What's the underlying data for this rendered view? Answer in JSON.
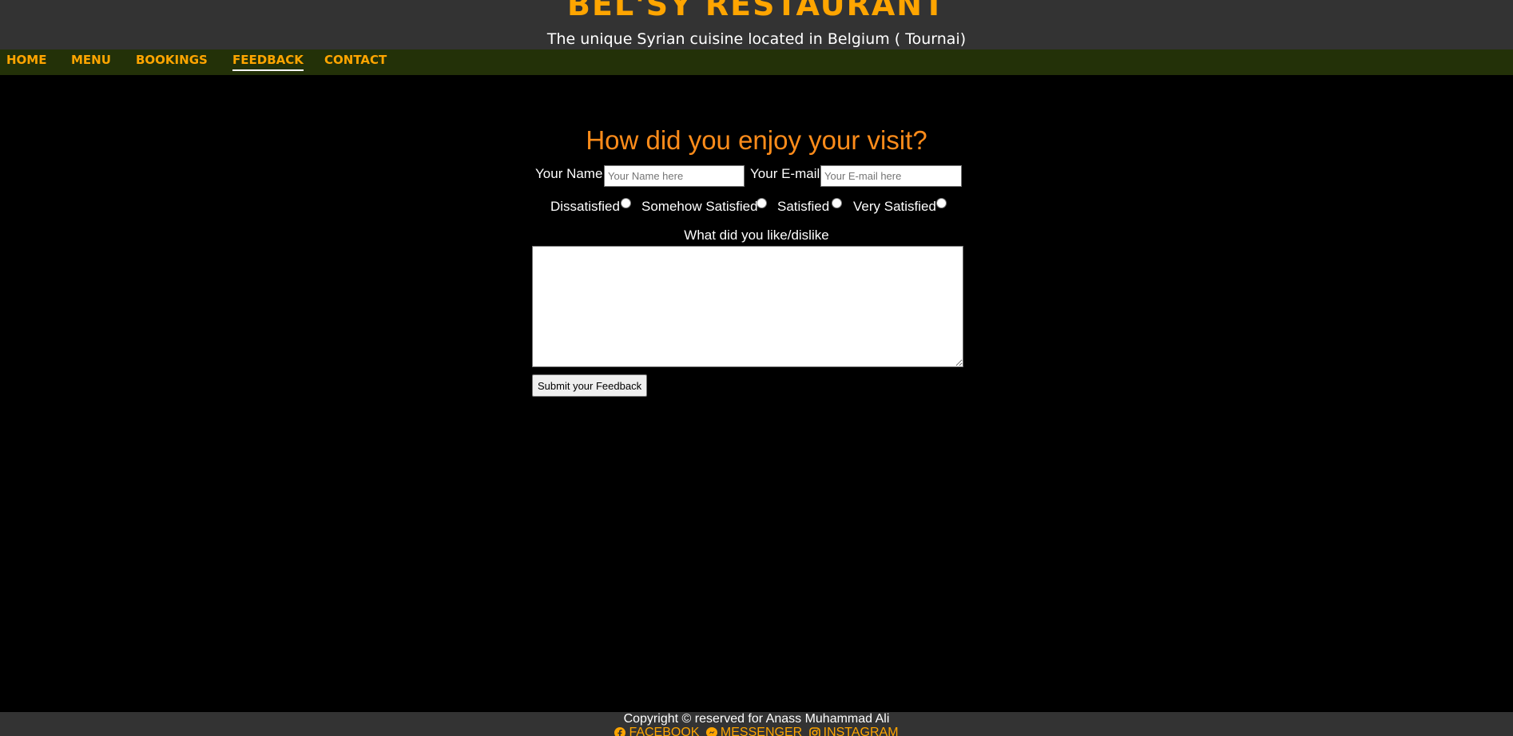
{
  "header": {
    "title": "BEL'SY RESTAURANT",
    "subtitle": "The unique Syrian cuisine located in Belgium ( Tournai)"
  },
  "nav": {
    "items": [
      {
        "label": "HOME"
      },
      {
        "label": "MENU"
      },
      {
        "label": "BOOKINGS"
      },
      {
        "label": "FEEDBACK",
        "active": true
      },
      {
        "label": "CONTACT"
      }
    ]
  },
  "form": {
    "heading": "How did you enjoy your visit?",
    "name_label": "Your Name",
    "name_placeholder": "Your Name here",
    "name_value": "",
    "email_label": "Your E-mail",
    "email_placeholder": "Your E-mail here",
    "email_value": "",
    "ratings": [
      {
        "label": "Dissatisfied",
        "checked": false
      },
      {
        "label": "Somehow Satisfied",
        "checked": false
      },
      {
        "label": "Satisfied",
        "checked": false
      },
      {
        "label": "Very Satisfied",
        "checked": false
      }
    ],
    "comments_label": "What did you like/dislike",
    "comments_value": "",
    "submit_label": "Submit your Feedback"
  },
  "footer": {
    "copyright": "Copyright © reserved for Anass Muhammad Ali",
    "social": [
      {
        "label": "FACEBOOK",
        "icon": "facebook-icon"
      },
      {
        "label": "MESSENGER",
        "icon": "messenger-icon"
      },
      {
        "label": "INSTAGRAM",
        "icon": "instagram-icon"
      }
    ]
  },
  "colors": {
    "accent": "#ffa500",
    "heading": "#ff8c1a",
    "header_bg": "#333333",
    "nav_bg": "#233108",
    "page_bg": "#000000"
  }
}
